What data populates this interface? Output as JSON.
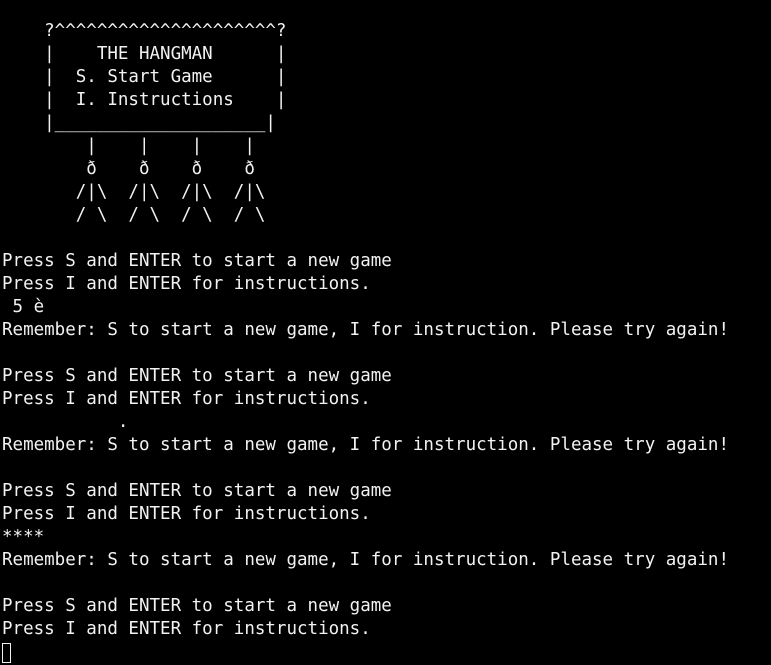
{
  "terminal": {
    "lines": [
      "    ?^^^^^^^^^^^^^^^^^^^^^?",
      "    |    THE HANGMAN      |",
      "    |  S. Start Game      |",
      "    |  I. Instructions    |",
      "    |____________________|",
      "        |    |    |    |",
      "        ð    ð    ð    ð",
      "       /|\\  /|\\  /|\\  /|\\",
      "       / \\  / \\  / \\  / \\",
      "",
      "Press S and ENTER to start a new game",
      "Press I and ENTER for instructions.",
      " 5 è",
      "Remember: S to start a new game, I for instruction. Please try again!",
      "",
      "Press S and ENTER to start a new game",
      "Press I and ENTER for instructions.",
      "           .",
      "Remember: S to start a new game, I for instruction. Please try again!",
      "",
      "Press S and ENTER to start a new game",
      "Press I and ENTER for instructions.",
      "****",
      "Remember: S to start a new game, I for instruction. Please try again!",
      "",
      "Press S and ENTER to start a new game",
      "Press I and ENTER for instructions."
    ]
  },
  "colors": {
    "background": "#000000",
    "foreground": "#f2f2f2"
  }
}
